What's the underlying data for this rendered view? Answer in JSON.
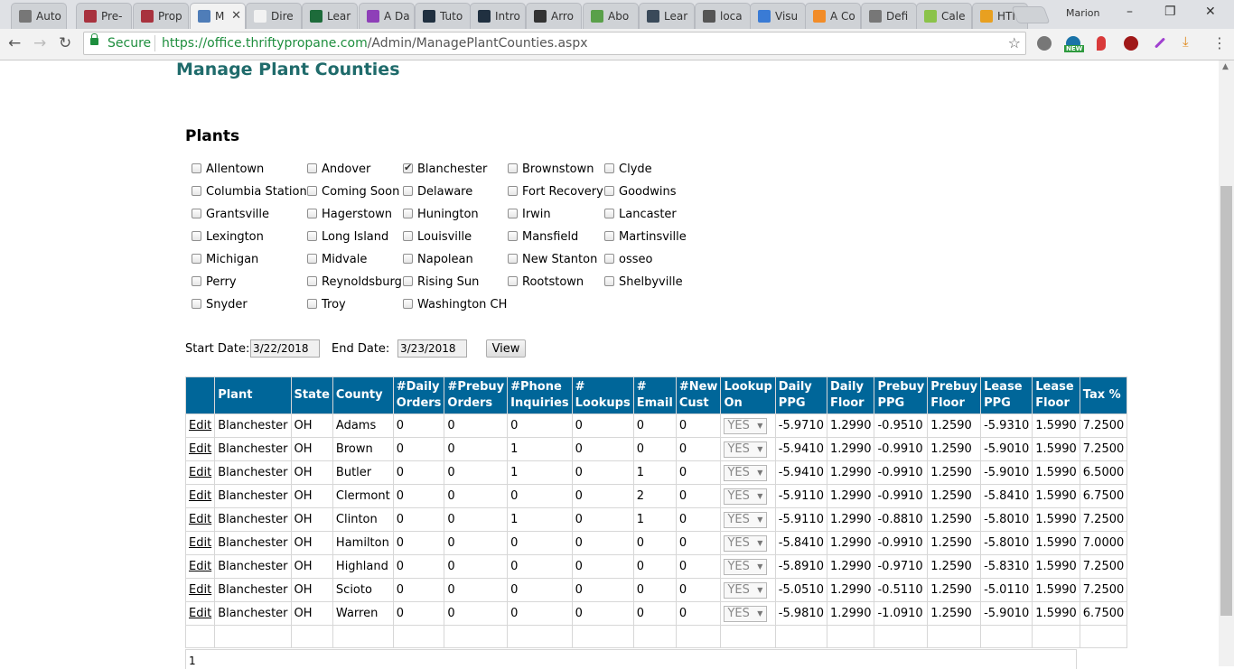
{
  "browser": {
    "tabs": [
      {
        "label": "Auto",
        "color": "#777777"
      },
      {
        "label": "Pre-",
        "color": "#a8323e"
      },
      {
        "label": "Prop",
        "color": "#a8323e"
      },
      {
        "label": "M",
        "color": "#4f7db8",
        "active": true
      },
      {
        "label": "Dire",
        "color": "#f2f2f2"
      },
      {
        "label": "Lear",
        "color": "#1d6b3a"
      },
      {
        "label": "A Da",
        "color": "#8e3fb8"
      },
      {
        "label": "Tuto",
        "color": "#203040"
      },
      {
        "label": "Intro",
        "color": "#203040"
      },
      {
        "label": "Arro",
        "color": "#333333"
      },
      {
        "label": "Abo",
        "color": "#5aa04a"
      },
      {
        "label": "Lear",
        "color": "#3a4a5a"
      },
      {
        "label": "loca",
        "color": "#555555"
      },
      {
        "label": "Visu",
        "color": "#3a7bd5"
      },
      {
        "label": "A Co",
        "color": "#f28c28"
      },
      {
        "label": "Defi",
        "color": "#777777"
      },
      {
        "label": "Cale",
        "color": "#8bc34a"
      },
      {
        "label": "HTM",
        "color": "#e8a020"
      }
    ],
    "user": "Marion",
    "secure_label": "Secure",
    "url_host": "https://office.thriftypropane.com",
    "url_path": "/Admin/ManagePlantCounties.aspx",
    "ext_badge": "NEW"
  },
  "page": {
    "title": "Manage Plant Counties",
    "plants_heading": "Plants",
    "plants": [
      [
        {
          "label": "Allentown",
          "checked": false
        },
        {
          "label": "Andover",
          "checked": false
        },
        {
          "label": "Blanchester",
          "checked": true
        },
        {
          "label": "Brownstown",
          "checked": false
        },
        {
          "label": "Clyde",
          "checked": false
        }
      ],
      [
        {
          "label": "Columbia Station",
          "checked": false
        },
        {
          "label": "Coming Soon",
          "checked": false
        },
        {
          "label": "Delaware",
          "checked": false
        },
        {
          "label": "Fort Recovery",
          "checked": false
        },
        {
          "label": "Goodwins",
          "checked": false
        }
      ],
      [
        {
          "label": "Grantsville",
          "checked": false
        },
        {
          "label": "Hagerstown",
          "checked": false
        },
        {
          "label": "Hunington",
          "checked": false
        },
        {
          "label": "Irwin",
          "checked": false
        },
        {
          "label": "Lancaster",
          "checked": false
        }
      ],
      [
        {
          "label": "Lexington",
          "checked": false
        },
        {
          "label": "Long Island",
          "checked": false
        },
        {
          "label": "Louisville",
          "checked": false
        },
        {
          "label": "Mansfield",
          "checked": false
        },
        {
          "label": "Martinsville",
          "checked": false
        }
      ],
      [
        {
          "label": "Michigan",
          "checked": false
        },
        {
          "label": "Midvale",
          "checked": false
        },
        {
          "label": "Napolean",
          "checked": false
        },
        {
          "label": "New Stanton",
          "checked": false
        },
        {
          "label": "osseo",
          "checked": false
        }
      ],
      [
        {
          "label": "Perry",
          "checked": false
        },
        {
          "label": "Reynoldsburg",
          "checked": false
        },
        {
          "label": "Rising Sun",
          "checked": false
        },
        {
          "label": "Rootstown",
          "checked": false
        },
        {
          "label": "Shelbyville",
          "checked": false
        }
      ],
      [
        {
          "label": "Snyder",
          "checked": false
        },
        {
          "label": "Troy",
          "checked": false
        },
        {
          "label": "Washington CH",
          "checked": false
        }
      ]
    ],
    "start_label": "Start Date:",
    "start_value": "3/22/2018",
    "end_label": "End Date:",
    "end_value": "3/23/2018",
    "view_label": "View"
  },
  "grid": {
    "headers": [
      "",
      "Plant",
      "State",
      "County",
      "#Daily Orders",
      "#Prebuy Orders",
      "#Phone Inquiries",
      "# Lookups",
      "# Email",
      "#New Cust",
      "Lookup On",
      "Daily PPG",
      "Daily Floor",
      "Prebuy PPG",
      "Prebuy Floor",
      "Lease PPG",
      "Lease Floor",
      "Tax %"
    ],
    "edit_label": "Edit",
    "rows": [
      [
        "Blanchester",
        "OH",
        "Adams",
        "0",
        "0",
        "0",
        "0",
        "0",
        "0",
        "YES",
        "-5.9710",
        "1.2990",
        "-0.9510",
        "1.2590",
        "-5.9310",
        "1.5990",
        "7.2500"
      ],
      [
        "Blanchester",
        "OH",
        "Brown",
        "0",
        "0",
        "1",
        "0",
        "0",
        "0",
        "YES",
        "-5.9410",
        "1.2990",
        "-0.9910",
        "1.2590",
        "-5.9010",
        "1.5990",
        "7.2500"
      ],
      [
        "Blanchester",
        "OH",
        "Butler",
        "0",
        "0",
        "1",
        "0",
        "1",
        "0",
        "YES",
        "-5.9410",
        "1.2990",
        "-0.9910",
        "1.2590",
        "-5.9010",
        "1.5990",
        "6.5000"
      ],
      [
        "Blanchester",
        "OH",
        "Clermont",
        "0",
        "0",
        "0",
        "0",
        "2",
        "0",
        "YES",
        "-5.9110",
        "1.2990",
        "-0.9910",
        "1.2590",
        "-5.8410",
        "1.5990",
        "6.7500"
      ],
      [
        "Blanchester",
        "OH",
        "Clinton",
        "0",
        "0",
        "1",
        "0",
        "1",
        "0",
        "YES",
        "-5.9110",
        "1.2990",
        "-0.8810",
        "1.2590",
        "-5.8010",
        "1.5990",
        "7.2500"
      ],
      [
        "Blanchester",
        "OH",
        "Hamilton",
        "0",
        "0",
        "0",
        "0",
        "0",
        "0",
        "YES",
        "-5.8410",
        "1.2990",
        "-0.9910",
        "1.2590",
        "-5.8010",
        "1.5990",
        "7.0000"
      ],
      [
        "Blanchester",
        "OH",
        "Highland",
        "0",
        "0",
        "0",
        "0",
        "0",
        "0",
        "YES",
        "-5.8910",
        "1.2990",
        "-0.9710",
        "1.2590",
        "-5.8310",
        "1.5990",
        "7.2500"
      ],
      [
        "Blanchester",
        "OH",
        "Scioto",
        "0",
        "0",
        "0",
        "0",
        "0",
        "0",
        "YES",
        "-5.0510",
        "1.2990",
        "-0.5110",
        "1.2590",
        "-5.0110",
        "1.5990",
        "7.2500"
      ],
      [
        "Blanchester",
        "OH",
        "Warren",
        "0",
        "0",
        "0",
        "0",
        "0",
        "0",
        "YES",
        "-5.9810",
        "1.2990",
        "-1.0910",
        "1.2590",
        "-5.9010",
        "1.5990",
        "6.7500"
      ]
    ],
    "pager": "1"
  }
}
